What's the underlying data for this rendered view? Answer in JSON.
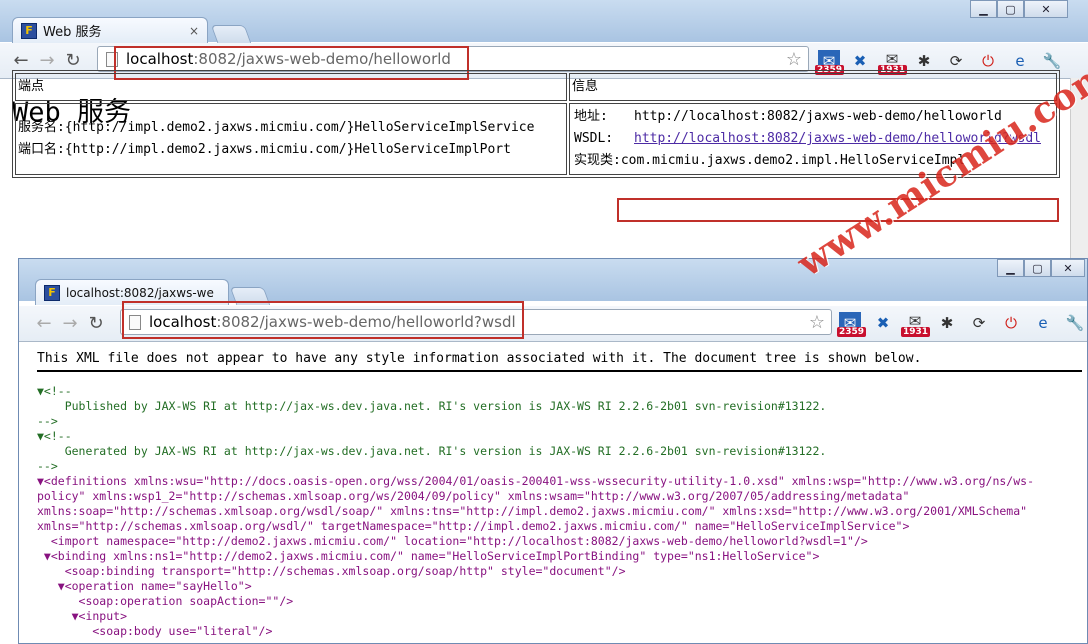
{
  "window1": {
    "tab_title": "Web 服务",
    "tab_close": "×",
    "url_host": "localhost",
    "url_path": ":8082/jaxws-web-demo/helloworld",
    "badge_a": "2359",
    "badge_b": "1931",
    "heading": "Web 服务",
    "table": {
      "col1_header": "端点",
      "col2_header": "信息",
      "service_name_label": "服务名:",
      "service_name_value": "{http://impl.demo2.jaxws.micmiu.com/}HelloServiceImplService",
      "port_name_label": "端口名:",
      "port_name_value": "{http://impl.demo2.jaxws.micmiu.com/}HelloServiceImplPort",
      "address_label": "地址:",
      "address_value": "http://localhost:8082/jaxws-web-demo/helloworld",
      "wsdl_label": "WSDL:",
      "wsdl_link": "http://localhost:8082/jaxws-web-demo/helloworld?wsdl",
      "impl_label": "实现类:",
      "impl_value": "com.micmiu.jaxws.demo2.impl.HelloServiceImpl"
    }
  },
  "window2": {
    "tab_title": "localhost:8082/jaxws-we",
    "url_host": "localhost",
    "url_path": ":8082/jaxws-web-demo/helloworld?wsdl",
    "badge_a": "2359",
    "badge_b": "1931",
    "notice": "This XML file does not appear to have any style information associated with it. The document tree is shown below.",
    "lines": [
      "▼<!--",
      "    Published by JAX-WS RI at http://jax-ws.dev.java.net. RI's version is JAX-WS RI 2.2.6-2b01 svn-revision#13122.",
      "-->",
      "▼<!--",
      "    Generated by JAX-WS RI at http://jax-ws.dev.java.net. RI's version is JAX-WS RI 2.2.6-2b01 svn-revision#13122.",
      "-->",
      "▼<definitions xmlns:wsu=\"http://docs.oasis-open.org/wss/2004/01/oasis-200401-wss-wssecurity-utility-1.0.xsd\" xmlns:wsp=\"http://www.w3.org/ns/ws-",
      "policy\" xmlns:wsp1_2=\"http://schemas.xmlsoap.org/ws/2004/09/policy\" xmlns:wsam=\"http://www.w3.org/2007/05/addressing/metadata\"",
      "xmlns:soap=\"http://schemas.xmlsoap.org/wsdl/soap/\" xmlns:tns=\"http://impl.demo2.jaxws.micmiu.com/\" xmlns:xsd=\"http://www.w3.org/2001/XMLSchema\"",
      "xmlns=\"http://schemas.xmlsoap.org/wsdl/\" targetNamespace=\"http://impl.demo2.jaxws.micmiu.com/\" name=\"HelloServiceImplService\">",
      "  <import namespace=\"http://demo2.jaxws.micmiu.com/\" location=\"http://localhost:8082/jaxws-web-demo/helloworld?wsdl=1\"/>",
      " ▼<binding xmlns:ns1=\"http://demo2.jaxws.micmiu.com/\" name=\"HelloServiceImplPortBinding\" type=\"ns1:HelloService\">",
      "    <soap:binding transport=\"http://schemas.xmlsoap.org/soap/http\" style=\"document\"/>",
      "   ▼<operation name=\"sayHello\">",
      "      <soap:operation soapAction=\"\"/>",
      "     ▼<input>",
      "        <soap:body use=\"literal\"/>"
    ]
  },
  "watermark": "www.micmiu.com"
}
